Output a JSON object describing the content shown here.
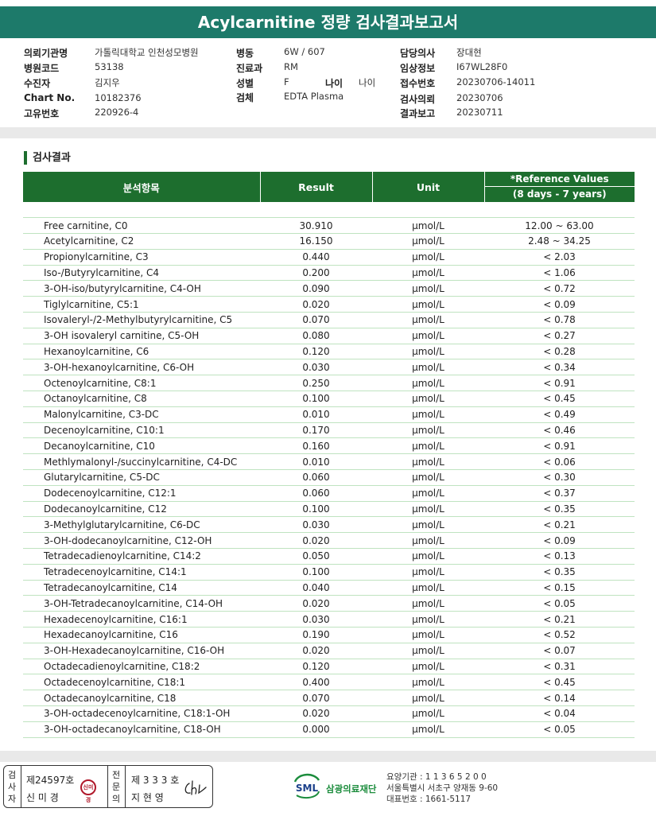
{
  "report_title": "Acylcarnitine 정량 검사결과보고서",
  "patient_info": {
    "col1": [
      {
        "label": "의뢰기관명",
        "value": "가톨릭대학교 인천성모병원"
      },
      {
        "label": "병원코드",
        "value": "53138"
      },
      {
        "label": "수진자",
        "value": "김지우"
      },
      {
        "label": "Chart No.",
        "value": "10182376"
      },
      {
        "label": "고유번호",
        "value": "220926-4"
      }
    ],
    "col2": [
      {
        "label": "병동",
        "value": "6W / 607"
      },
      {
        "label": "진료과",
        "value": "RM"
      },
      {
        "label": "성별",
        "value": "F"
      },
      {
        "label": "검체",
        "value": "EDTA Plasma"
      }
    ],
    "age": {
      "label": "나이",
      "value": "나이"
    },
    "col3": [
      {
        "label": "담당의사",
        "value": "장대현"
      },
      {
        "label": "임상정보",
        "value": "I67WL28F0"
      },
      {
        "label": "접수번호",
        "value": "20230706-14011"
      },
      {
        "label": "검사의뢰",
        "value": "20230706"
      },
      {
        "label": "결과보고",
        "value": "20230711"
      }
    ]
  },
  "section_title": "검사결과",
  "table": {
    "headers": {
      "item": "분석항목",
      "result": "Result",
      "unit": "Unit",
      "ref_line1": "*Reference Values",
      "ref_line2": "(8 days - 7 years)"
    },
    "rows": [
      {
        "name": "Free carnitine, C0",
        "result": "30.910",
        "unit": "μmol/L",
        "ref": "12.00 ~ 63.00"
      },
      {
        "name": "Acetylcarnitine, C2",
        "result": "16.150",
        "unit": "μmol/L",
        "ref": "2.48 ~ 34.25"
      },
      {
        "name": "Propionylcarnitine, C3",
        "result": "0.440",
        "unit": "μmol/L",
        "ref": "< 2.03"
      },
      {
        "name": "Iso-/Butyrylcarnitine, C4",
        "result": "0.200",
        "unit": "μmol/L",
        "ref": "< 1.06"
      },
      {
        "name": "3-OH-iso/butyrylcarnitine, C4-OH",
        "result": "0.090",
        "unit": "μmol/L",
        "ref": "< 0.72"
      },
      {
        "name": "Tiglylcarnitine, C5:1",
        "result": "0.020",
        "unit": "μmol/L",
        "ref": "< 0.09"
      },
      {
        "name": "Isovaleryl-/2-Methylbutyrylcarnitine, C5",
        "result": "0.070",
        "unit": "μmol/L",
        "ref": "< 0.78"
      },
      {
        "name": "3-OH isovaleryl carnitine, C5-OH",
        "result": "0.080",
        "unit": "μmol/L",
        "ref": "< 0.27"
      },
      {
        "name": "Hexanoylcarnitine, C6",
        "result": "0.120",
        "unit": "μmol/L",
        "ref": "< 0.28"
      },
      {
        "name": "3-OH-hexanoylcarnitine, C6-OH",
        "result": "0.030",
        "unit": "μmol/L",
        "ref": "< 0.34"
      },
      {
        "name": "Octenoylcarnitine, C8:1",
        "result": "0.250",
        "unit": "μmol/L",
        "ref": "< 0.91"
      },
      {
        "name": "Octanoylcarnitine, C8",
        "result": "0.100",
        "unit": "μmol/L",
        "ref": "< 0.45"
      },
      {
        "name": "Malonylcarnitine, C3-DC",
        "result": "0.010",
        "unit": "μmol/L",
        "ref": "< 0.49"
      },
      {
        "name": "Decenoylcarnitine, C10:1",
        "result": "0.170",
        "unit": "μmol/L",
        "ref": "< 0.46"
      },
      {
        "name": "Decanoylcarnitine, C10",
        "result": "0.160",
        "unit": "μmol/L",
        "ref": "< 0.91"
      },
      {
        "name": "Methlymalonyl-/succinylcarnitine, C4-DC",
        "result": "0.010",
        "unit": "μmol/L",
        "ref": "< 0.06"
      },
      {
        "name": "Glutarylcarnitine, C5-DC",
        "result": "0.060",
        "unit": "μmol/L",
        "ref": "< 0.30"
      },
      {
        "name": "Dodecenoylcarnitine, C12:1",
        "result": "0.060",
        "unit": "μmol/L",
        "ref": "< 0.37"
      },
      {
        "name": "Dodecanoylcarnitine, C12",
        "result": "0.100",
        "unit": "μmol/L",
        "ref": "< 0.35"
      },
      {
        "name": "3-Methylglutarylcarnitine, C6-DC",
        "result": "0.030",
        "unit": "μmol/L",
        "ref": "< 0.21"
      },
      {
        "name": "3-OH-dodecanoylcarnitine, C12-OH",
        "result": "0.020",
        "unit": "μmol/L",
        "ref": "< 0.09"
      },
      {
        "name": "Tetradecadienoylcarnitine, C14:2",
        "result": "0.050",
        "unit": "μmol/L",
        "ref": "< 0.13"
      },
      {
        "name": "Tetradecenoylcarnitine, C14:1",
        "result": "0.100",
        "unit": "μmol/L",
        "ref": "< 0.35"
      },
      {
        "name": "Tetradecanoylcarnitine, C14",
        "result": "0.040",
        "unit": "μmol/L",
        "ref": "< 0.15"
      },
      {
        "name": "3-OH-Tetradecanoylcarnitine, C14-OH",
        "result": "0.020",
        "unit": "μmol/L",
        "ref": "< 0.05"
      },
      {
        "name": "Hexadecenoylcarnitine, C16:1",
        "result": "0.030",
        "unit": "μmol/L",
        "ref": "< 0.21"
      },
      {
        "name": "Hexadecanoylcarnitine, C16",
        "result": "0.190",
        "unit": "μmol/L",
        "ref": "< 0.52"
      },
      {
        "name": "3-OH-Hexadecanoylcarnitine, C16-OH",
        "result": "0.020",
        "unit": "μmol/L",
        "ref": "< 0.07"
      },
      {
        "name": "Octadecadienoylcarnitine, C18:2",
        "result": "0.120",
        "unit": "μmol/L",
        "ref": "< 0.31"
      },
      {
        "name": "Octadecenoylcarnitine, C18:1",
        "result": "0.400",
        "unit": "μmol/L",
        "ref": "< 0.45"
      },
      {
        "name": "Octadecanoylcarnitine, C18",
        "result": "0.070",
        "unit": "μmol/L",
        "ref": "< 0.14"
      },
      {
        "name": "3-OH-octadecenoylcarnitine, C18:1-OH",
        "result": "0.020",
        "unit": "μmol/L",
        "ref": "< 0.04"
      },
      {
        "name": "3-OH-octadecanoylcarnitine, C18-OH",
        "result": "0.000",
        "unit": "μmol/L",
        "ref": "< 0.05"
      }
    ]
  },
  "footer": {
    "examiner_label": "검사자",
    "examiner_no": "제24597호",
    "examiner_name": "신 미 경",
    "stamp_text": "신미경",
    "specialist_label": "전문의",
    "specialist_no": "제 3 3 3 호",
    "specialist_name": "지 현 영",
    "logo_text": "SML",
    "org_name": "삼광의료재단",
    "org_code": "요양기관 : 1 1 3 6 5 2 0 0",
    "org_address": "서울특별시 서초구 양재동 9-60",
    "org_phone": "대표번호 : 1661-5117",
    "accent_color": "#1d6e2e",
    "title_color": "#1d7a6a"
  }
}
